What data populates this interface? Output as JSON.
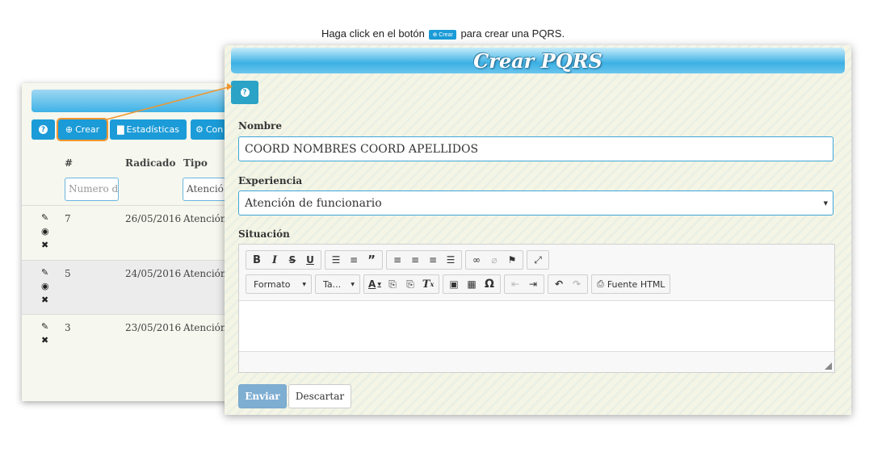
{
  "caption": {
    "before": "Haga click en el botón",
    "button": "Crear",
    "after": "para crear una PQRS."
  },
  "list_panel": {
    "buttons": {
      "help": "?",
      "crear": "Crear",
      "estadisticas": "Estadísticas",
      "config": "Con"
    },
    "columns": [
      "#",
      "Radicado",
      "Tipo"
    ],
    "filters": {
      "number_placeholder": "Numero d",
      "tipo_value": "Atenció"
    },
    "rows": [
      {
        "num": "7",
        "date": "26/05/2016",
        "tipo": "Atención d"
      },
      {
        "num": "5",
        "date": "24/05/2016",
        "tipo": "Atención d"
      },
      {
        "num": "3",
        "date": "23/05/2016",
        "tipo": "Atención d"
      }
    ],
    "accent_color": "#1b9bd7",
    "highlight_color": "#f0962e"
  },
  "form": {
    "title": "Crear PQRS",
    "help_button": "?",
    "nombre": {
      "label": "Nombre",
      "value": "COORD NOMBRES COORD APELLIDOS"
    },
    "experiencia": {
      "label": "Experiencia",
      "value": "Atención de funcionario"
    },
    "situacion": {
      "label": "Situación",
      "toolbar": {
        "formato": "Formato",
        "tamano": "Ta...",
        "fuente_html": "Fuente HTML"
      },
      "content": ""
    },
    "enviar_label": "Enviar",
    "descartar_label": "Descartar"
  }
}
